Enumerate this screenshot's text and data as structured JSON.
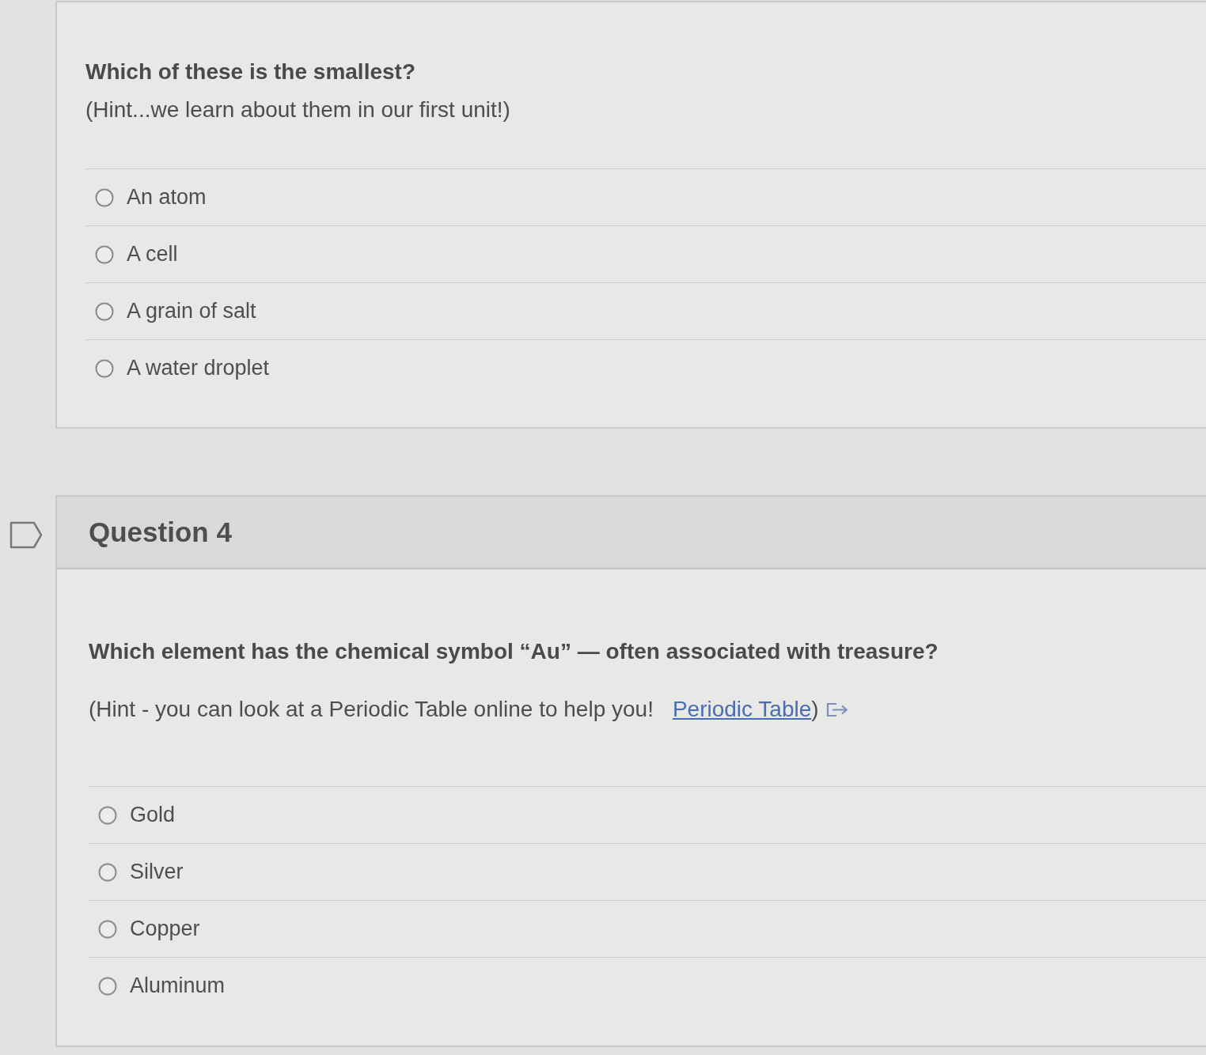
{
  "questions": [
    {
      "prompt": "Which of these is the smallest?",
      "hint": {
        "text": "(Hint...we learn about them in our first unit!)"
      },
      "answers": [
        {
          "label": "An atom",
          "selected": false
        },
        {
          "label": "A cell",
          "selected": false
        },
        {
          "label": "A grain of salt",
          "selected": false
        },
        {
          "label": "A water droplet",
          "selected": false
        }
      ]
    },
    {
      "title": "Question 4",
      "flagged": false,
      "prompt": "Which element has the chemical symbol “Au” — often associated with treasure?",
      "hint": {
        "text": "(Hint - you can look at a Periodic Table online to help you!",
        "link": "Periodic Table",
        "after": ")"
      },
      "answers": [
        {
          "label": "Gold",
          "selected": false
        },
        {
          "label": "Silver",
          "selected": false
        },
        {
          "label": "Copper",
          "selected": false
        },
        {
          "label": "Aluminum",
          "selected": false
        }
      ]
    }
  ]
}
